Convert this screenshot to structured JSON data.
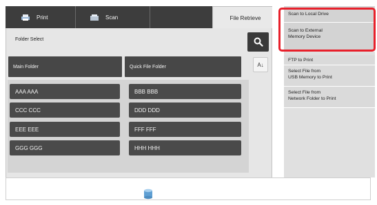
{
  "tabs": {
    "print": "Print",
    "scan": "Scan",
    "file_retrieve": "File Retrieve"
  },
  "panel": {
    "folder_select": "Folder Select",
    "header_left": "Main Folder",
    "header_right": "Quick File Folder",
    "sort_label": "A↓"
  },
  "folders": {
    "left": [
      "AAA AAA",
      "CCC CCC",
      "EEE EEE",
      "GGG GGG"
    ],
    "right": [
      "BBB BBB",
      "DDD DDD",
      "FFF FFF",
      "HHH HHH"
    ]
  },
  "side_menu": {
    "scan_local": "Scan to Local Drive",
    "scan_external_1": "Scan to External",
    "scan_external_2": "Memory Device",
    "ftp": "FTP to Print",
    "usb_1": "Select File from",
    "usb_2": "USB Memory to Print",
    "network_1": "Select File from",
    "network_2": "Network Folder to Print"
  },
  "icons": {
    "print": "printer-icon",
    "scan": "scanner-icon",
    "search": "search-icon",
    "sort": "sort-icon",
    "storage": "database-icon"
  },
  "colors": {
    "highlight": "#e8202b",
    "dark_button": "#474747"
  }
}
